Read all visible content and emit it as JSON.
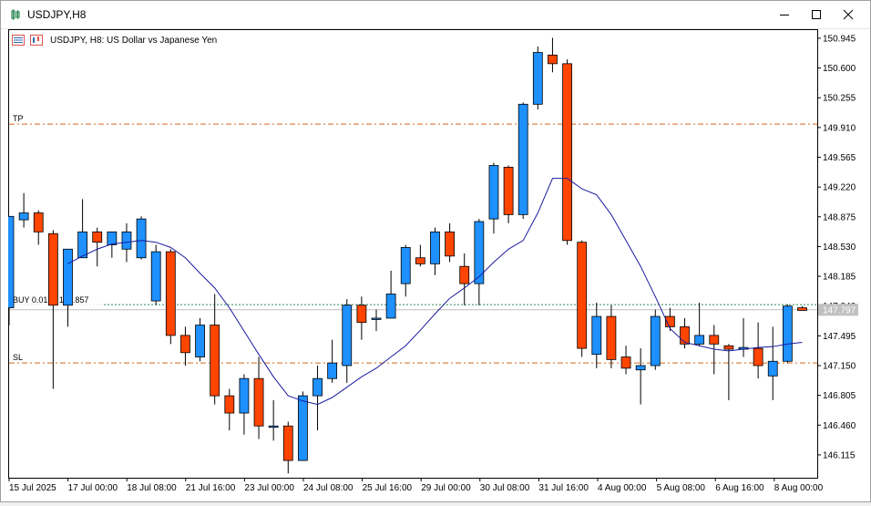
{
  "window": {
    "title": "USDJPY,H8",
    "controls": [
      "minimize",
      "maximize",
      "close"
    ]
  },
  "chart_header": {
    "title": "USDJPY, H8:  US Dollar vs Japanese Yen"
  },
  "colors": {
    "bull": "#1e90ff",
    "bear": "#ff4500",
    "ma": "#1a1aa0",
    "tp_sl": "#d2691e",
    "buy_line": "#2e8b57",
    "bid_line": "#c0c0c0"
  },
  "levels": {
    "tp": {
      "label": "TP",
      "price": 149.95
    },
    "sl": {
      "label": "SL",
      "price": 147.18
    },
    "buy": {
      "label": "BUY 0.01 at 147.857",
      "price": 147.857
    },
    "bid": {
      "price": 147.797
    }
  },
  "price_axis": {
    "ticks": [
      "150.945",
      "150.600",
      "150.255",
      "149.910",
      "149.565",
      "149.220",
      "148.875",
      "148.530",
      "148.185",
      "147.840",
      "147.495",
      "147.150",
      "146.805",
      "146.460",
      "146.115"
    ],
    "current_label": "147.797"
  },
  "time_axis": {
    "labels": [
      "15 Jul 2025",
      "17 Jul 00:00",
      "18 Jul 08:00",
      "21 Jul 16:00",
      "23 Jul 00:00",
      "24 Jul 08:00",
      "25 Jul 16:00",
      "29 Jul 00:00",
      "30 Jul 08:00",
      "31 Jul 16:00",
      "4 Aug 00:00",
      "5 Aug 08:00",
      "6 Aug 16:00",
      "8 Aug 00:00"
    ]
  },
  "chart_data": {
    "type": "candlestick",
    "symbol": "USDJPY",
    "timeframe": "H8",
    "ylim": [
      145.85,
      151.05
    ],
    "candles": [
      {
        "o": 147.82,
        "h": 148.88,
        "l": 147.62,
        "c": 148.88
      },
      {
        "o": 148.84,
        "h": 149.15,
        "l": 148.75,
        "c": 148.92
      },
      {
        "o": 148.92,
        "h": 148.95,
        "l": 148.55,
        "c": 148.7
      },
      {
        "o": 148.68,
        "h": 148.72,
        "l": 146.88,
        "c": 147.85
      },
      {
        "o": 147.85,
        "h": 148.5,
        "l": 147.6,
        "c": 148.5
      },
      {
        "o": 148.4,
        "h": 149.08,
        "l": 148.4,
        "c": 148.7
      },
      {
        "o": 148.7,
        "h": 148.75,
        "l": 148.3,
        "c": 148.58
      },
      {
        "o": 148.55,
        "h": 148.7,
        "l": 148.4,
        "c": 148.7
      },
      {
        "o": 148.5,
        "h": 148.8,
        "l": 148.35,
        "c": 148.7
      },
      {
        "o": 148.4,
        "h": 148.88,
        "l": 148.38,
        "c": 148.85
      },
      {
        "o": 147.9,
        "h": 148.55,
        "l": 147.85,
        "c": 148.47
      },
      {
        "o": 148.47,
        "h": 148.5,
        "l": 147.4,
        "c": 147.5
      },
      {
        "o": 147.5,
        "h": 147.6,
        "l": 147.15,
        "c": 147.3
      },
      {
        "o": 147.25,
        "h": 147.7,
        "l": 147.2,
        "c": 147.62
      },
      {
        "o": 147.62,
        "h": 147.98,
        "l": 146.7,
        "c": 146.8
      },
      {
        "o": 146.8,
        "h": 146.88,
        "l": 146.4,
        "c": 146.6
      },
      {
        "o": 146.6,
        "h": 147.05,
        "l": 146.35,
        "c": 147.0
      },
      {
        "o": 147.0,
        "h": 147.25,
        "l": 146.3,
        "c": 146.45
      },
      {
        "o": 146.45,
        "h": 146.75,
        "l": 146.28,
        "c": 146.45
      },
      {
        "o": 146.45,
        "h": 146.5,
        "l": 145.9,
        "c": 146.05
      },
      {
        "o": 146.05,
        "h": 146.85,
        "l": 146.05,
        "c": 146.8
      },
      {
        "o": 146.8,
        "h": 147.15,
        "l": 146.4,
        "c": 147.0
      },
      {
        "o": 147.0,
        "h": 147.45,
        "l": 146.95,
        "c": 147.18
      },
      {
        "o": 147.15,
        "h": 147.92,
        "l": 146.95,
        "c": 147.85
      },
      {
        "o": 147.85,
        "h": 147.95,
        "l": 147.45,
        "c": 147.65
      },
      {
        "o": 147.7,
        "h": 147.8,
        "l": 147.55,
        "c": 147.7
      },
      {
        "o": 147.7,
        "h": 148.25,
        "l": 147.7,
        "c": 147.98
      },
      {
        "o": 148.1,
        "h": 148.55,
        "l": 147.95,
        "c": 148.52
      },
      {
        "o": 148.4,
        "h": 148.55,
        "l": 148.3,
        "c": 148.33
      },
      {
        "o": 148.33,
        "h": 148.75,
        "l": 148.2,
        "c": 148.7
      },
      {
        "o": 148.7,
        "h": 148.8,
        "l": 148.35,
        "c": 148.42
      },
      {
        "o": 148.3,
        "h": 148.45,
        "l": 147.85,
        "c": 148.1
      },
      {
        "o": 148.1,
        "h": 148.85,
        "l": 147.85,
        "c": 148.82
      },
      {
        "o": 148.85,
        "h": 149.5,
        "l": 148.68,
        "c": 149.47
      },
      {
        "o": 149.45,
        "h": 149.47,
        "l": 148.8,
        "c": 148.9
      },
      {
        "o": 148.9,
        "h": 150.2,
        "l": 148.85,
        "c": 150.18
      },
      {
        "o": 150.18,
        "h": 150.85,
        "l": 150.12,
        "c": 150.78
      },
      {
        "o": 150.75,
        "h": 150.95,
        "l": 150.55,
        "c": 150.65
      },
      {
        "o": 150.65,
        "h": 150.7,
        "l": 148.55,
        "c": 148.6
      },
      {
        "o": 148.58,
        "h": 148.6,
        "l": 147.25,
        "c": 147.35
      },
      {
        "o": 147.28,
        "h": 147.88,
        "l": 147.12,
        "c": 147.72
      },
      {
        "o": 147.72,
        "h": 147.85,
        "l": 147.12,
        "c": 147.22
      },
      {
        "o": 147.25,
        "h": 147.38,
        "l": 147.05,
        "c": 147.12
      },
      {
        "o": 147.1,
        "h": 147.35,
        "l": 146.7,
        "c": 147.15
      },
      {
        "o": 147.15,
        "h": 147.8,
        "l": 147.1,
        "c": 147.72
      },
      {
        "o": 147.72,
        "h": 147.82,
        "l": 147.55,
        "c": 147.6
      },
      {
        "o": 147.6,
        "h": 147.7,
        "l": 147.35,
        "c": 147.4
      },
      {
        "o": 147.4,
        "h": 147.88,
        "l": 147.38,
        "c": 147.5
      },
      {
        "o": 147.5,
        "h": 147.62,
        "l": 147.05,
        "c": 147.4
      },
      {
        "o": 147.38,
        "h": 147.4,
        "l": 146.75,
        "c": 147.34
      },
      {
        "o": 147.34,
        "h": 147.7,
        "l": 147.25,
        "c": 147.36
      },
      {
        "o": 147.35,
        "h": 147.65,
        "l": 147.0,
        "c": 147.15
      },
      {
        "o": 147.03,
        "h": 147.6,
        "l": 146.75,
        "c": 147.2
      },
      {
        "o": 147.2,
        "h": 147.86,
        "l": 147.18,
        "c": 147.84
      },
      {
        "o": 147.82,
        "h": 147.84,
        "l": 147.79,
        "c": 147.79
      }
    ],
    "moving_average": [
      null,
      null,
      null,
      null,
      148.33,
      148.42,
      148.5,
      148.56,
      148.58,
      148.6,
      148.58,
      148.52,
      148.4,
      148.22,
      148.05,
      147.82,
      147.55,
      147.28,
      147.02,
      146.8,
      146.74,
      146.7,
      146.78,
      146.9,
      147.02,
      147.12,
      147.25,
      147.38,
      147.56,
      147.75,
      147.93,
      148.05,
      148.18,
      148.35,
      148.5,
      148.6,
      148.92,
      149.32,
      149.32,
      149.2,
      149.13,
      148.9,
      148.6,
      148.3,
      147.95,
      147.58,
      147.42,
      147.38,
      147.34,
      147.32,
      147.34,
      147.36,
      147.37,
      147.4,
      147.42
    ]
  }
}
